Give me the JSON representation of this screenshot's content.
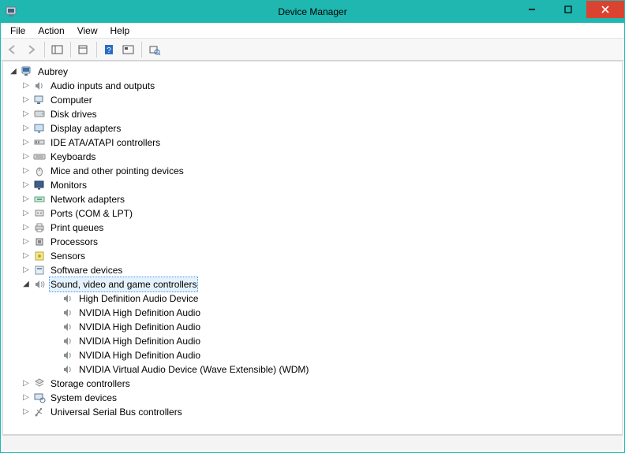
{
  "window": {
    "title": "Device Manager"
  },
  "menu": {
    "file": "File",
    "action": "Action",
    "view": "View",
    "help": "Help"
  },
  "tree": {
    "root": "Aubrey",
    "categories": [
      {
        "label": "Audio inputs and outputs",
        "icon": "speaker"
      },
      {
        "label": "Computer",
        "icon": "computer"
      },
      {
        "label": "Disk drives",
        "icon": "disk"
      },
      {
        "label": "Display adapters",
        "icon": "display"
      },
      {
        "label": "IDE ATA/ATAPI controllers",
        "icon": "ide"
      },
      {
        "label": "Keyboards",
        "icon": "keyboard"
      },
      {
        "label": "Mice and other pointing devices",
        "icon": "mouse"
      },
      {
        "label": "Monitors",
        "icon": "monitor"
      },
      {
        "label": "Network adapters",
        "icon": "network"
      },
      {
        "label": "Ports (COM & LPT)",
        "icon": "port"
      },
      {
        "label": "Print queues",
        "icon": "printer"
      },
      {
        "label": "Processors",
        "icon": "cpu"
      },
      {
        "label": "Sensors",
        "icon": "sensor"
      },
      {
        "label": "Software devices",
        "icon": "software"
      },
      {
        "label": "Sound, video and game controllers",
        "icon": "sound",
        "expanded": true,
        "selected": true,
        "children": [
          "High Definition Audio Device",
          "NVIDIA High Definition Audio",
          "NVIDIA High Definition Audio",
          "NVIDIA High Definition Audio",
          "NVIDIA High Definition Audio",
          "NVIDIA Virtual Audio Device (Wave Extensible) (WDM)"
        ]
      },
      {
        "label": "Storage controllers",
        "icon": "storage"
      },
      {
        "label": "System devices",
        "icon": "system"
      },
      {
        "label": "Universal Serial Bus controllers",
        "icon": "usb"
      }
    ]
  }
}
